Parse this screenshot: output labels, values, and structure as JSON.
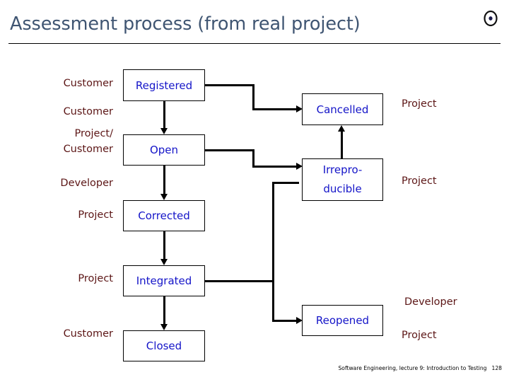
{
  "slide": {
    "title": "Assessment process (from real project)",
    "icon": "disc-icon",
    "colors": {
      "title": "#3f5572",
      "role_label": "#5c1616",
      "state_text": "#1414c8",
      "connector": "#000000",
      "background": "#ffffff"
    }
  },
  "states": [
    {
      "id": "registered",
      "label": "Registered"
    },
    {
      "id": "cancelled",
      "label": "Cancelled"
    },
    {
      "id": "open",
      "label": "Open"
    },
    {
      "id": "irreproducible",
      "label_line1": "Irrepro-",
      "label_line2": "ducible"
    },
    {
      "id": "corrected",
      "label": "Corrected"
    },
    {
      "id": "integrated",
      "label": "Integrated"
    },
    {
      "id": "reopened",
      "label": "Reopened"
    },
    {
      "id": "closed",
      "label": "Closed"
    }
  ],
  "roles_left": [
    {
      "id": "role-registered",
      "label": "Customer"
    },
    {
      "id": "role-open-a",
      "label": "Customer"
    },
    {
      "id": "role-open-b-line1",
      "label": "Project/"
    },
    {
      "id": "role-open-b-line2",
      "label": "Customer"
    },
    {
      "id": "role-developer",
      "label": "Developer"
    },
    {
      "id": "role-corrected",
      "label": "Project"
    },
    {
      "id": "role-integrated",
      "label": "Project"
    },
    {
      "id": "role-closed",
      "label": "Customer"
    }
  ],
  "roles_right": [
    {
      "id": "role-cancelled",
      "label": "Project"
    },
    {
      "id": "role-irreproducible",
      "label": "Project"
    },
    {
      "id": "role-reopened-dev",
      "label": "Developer"
    },
    {
      "id": "role-reopened-proj",
      "label": "Project"
    }
  ],
  "footer": {
    "text": "Software Engineering, lecture 9: Introduction to Testing",
    "page": "128"
  }
}
